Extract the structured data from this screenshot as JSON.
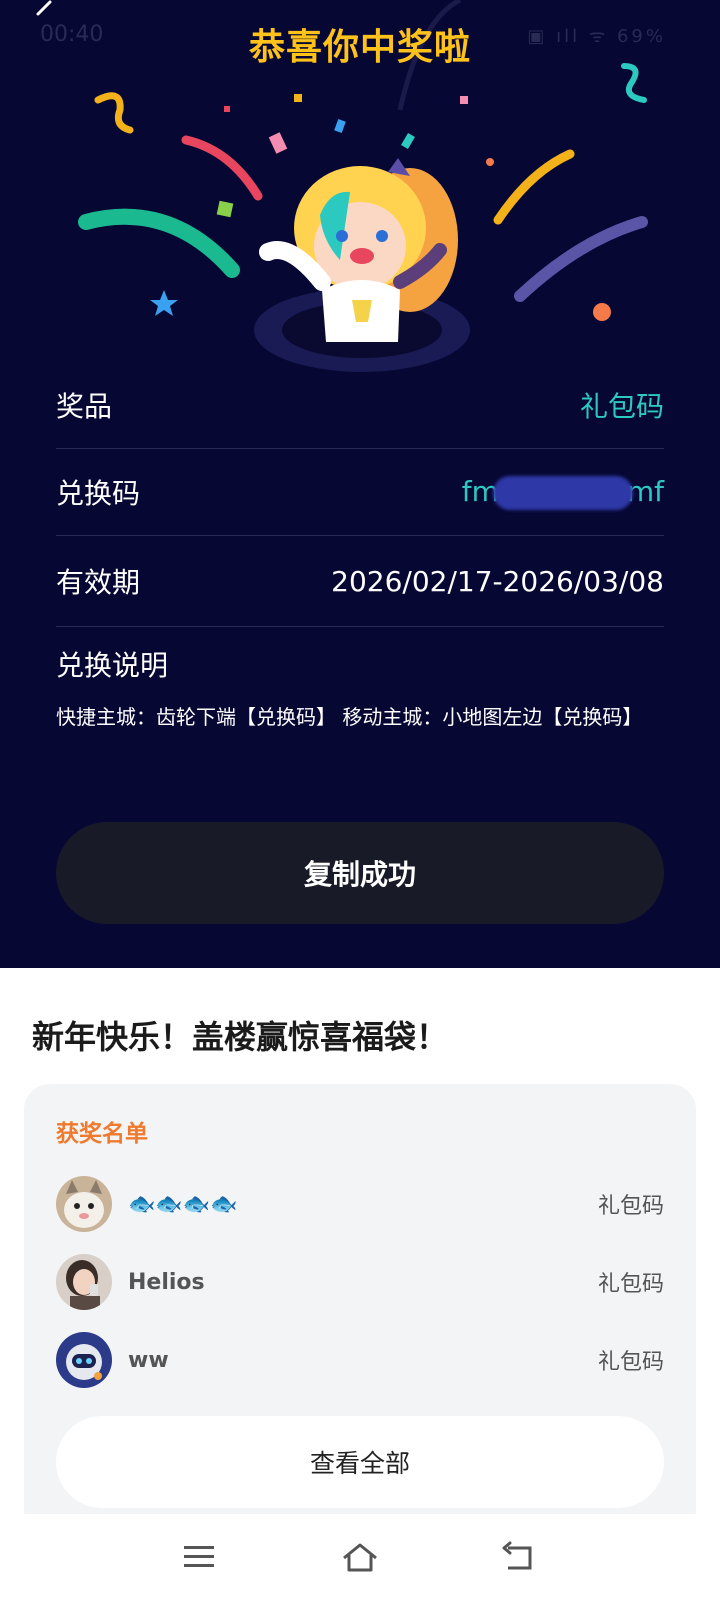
{
  "status_bar": {
    "time": "00:40",
    "icons": "▣ ıll ᯤ 69%"
  },
  "header": {
    "title": "恭喜你中奖啦"
  },
  "prize_info": {
    "prize_label": "奖品",
    "prize_value": "礼包码",
    "code_label": "兑换码",
    "code_prefix": "fm",
    "code_suffix": "mf",
    "validity_label": "有效期",
    "validity_value": "2026/02/17-2026/03/08",
    "instructions_label": "兑换说明",
    "instructions_text": "快捷主城：齿轮下端【兑换码】 移动主城：小地图左边【兑换码】"
  },
  "copy_button": {
    "label": "复制成功"
  },
  "promo": {
    "title": "新年快乐！盖楼赢惊喜福袋！"
  },
  "winners": {
    "title": "获奖名单",
    "items": [
      {
        "name": "🐟🐟🐟🐟",
        "prize": "礼包码",
        "avatar": "cat-avatar"
      },
      {
        "name": "Helios",
        "prize": "礼包码",
        "avatar": "person-avatar"
      },
      {
        "name": "ww",
        "prize": "礼包码",
        "avatar": "robot-avatar"
      }
    ],
    "view_all_label": "查看全部"
  },
  "colors": {
    "hero_bg": "#070733",
    "title_gold": "#ffc21a",
    "teal": "#2cc9c0",
    "winners_title_orange": "#ef7a2d"
  },
  "nav": {
    "icons": [
      "menu-icon",
      "home-icon",
      "back-icon"
    ]
  }
}
